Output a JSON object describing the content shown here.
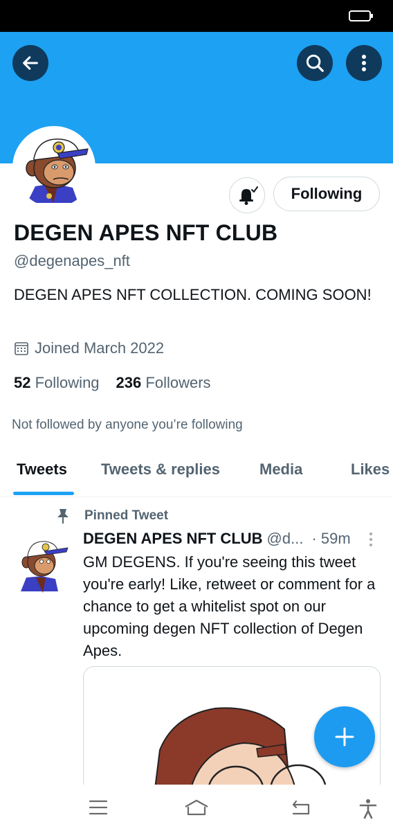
{
  "profile": {
    "display_name": "DEGEN APES NFT CLUB",
    "handle": "@degenapes_nft",
    "bio": "DEGEN APES NFT COLLECTION. COMING SOON!",
    "joined": "Joined March 2022",
    "following_count": "52",
    "following_label": "Following",
    "followers_count": "236",
    "followers_label": "Followers",
    "not_followed_note": "Not followed by anyone you’re following"
  },
  "actions": {
    "following_button": "Following"
  },
  "tabs": [
    {
      "label": "Tweets",
      "active": true
    },
    {
      "label": "Tweets & replies",
      "active": false
    },
    {
      "label": "Media",
      "active": false
    },
    {
      "label": "Likes",
      "active": false
    }
  ],
  "pinned_tweet": {
    "pinned_label": "Pinned Tweet",
    "author_name": "DEGEN APES NFT CLUB",
    "author_handle": "@d...",
    "time": "· 59m",
    "text": "GM DEGENS. If you're seeing this tweet you're early! Like, retweet or comment for a chance to get a whitelist spot on our upcoming degen NFT collection of Degen Apes."
  },
  "icons": {
    "back": "arrow-left-icon",
    "search": "search-icon",
    "more": "more-vertical-icon",
    "bell": "bell-check-icon",
    "calendar": "calendar-icon",
    "pin": "pin-icon",
    "compose": "plus-icon",
    "nav_menu": "menu-icon",
    "nav_home": "home-icon",
    "nav_back": "back-icon",
    "nav_accessibility": "accessibility-icon"
  },
  "colors": {
    "banner": "#1da1f2",
    "accent": "#1d9bf0",
    "text_primary": "#0f1419",
    "text_secondary": "#536471"
  }
}
